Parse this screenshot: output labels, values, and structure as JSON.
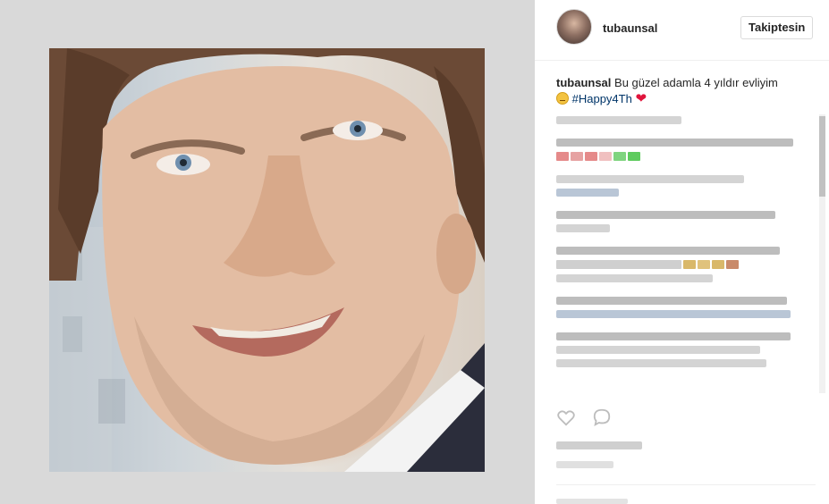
{
  "header": {
    "username": "tubaunsal",
    "follow_label": "Takiptesin"
  },
  "caption": {
    "username": "tubaunsal",
    "text": "Bu güzel adamla 4 yıldır evliyim",
    "hashtag": "#Happy4Th",
    "emoji_icon": "grimacing-face-icon",
    "heart_icon": "red-heart-icon",
    "heart_char": "❤"
  },
  "colors": {
    "hashtag": "#003569",
    "media_background": "#d9d9d9",
    "heart": "#e0143c"
  },
  "icons": {
    "like": "heart-outline-icon",
    "comment": "comment-bubble-icon"
  }
}
